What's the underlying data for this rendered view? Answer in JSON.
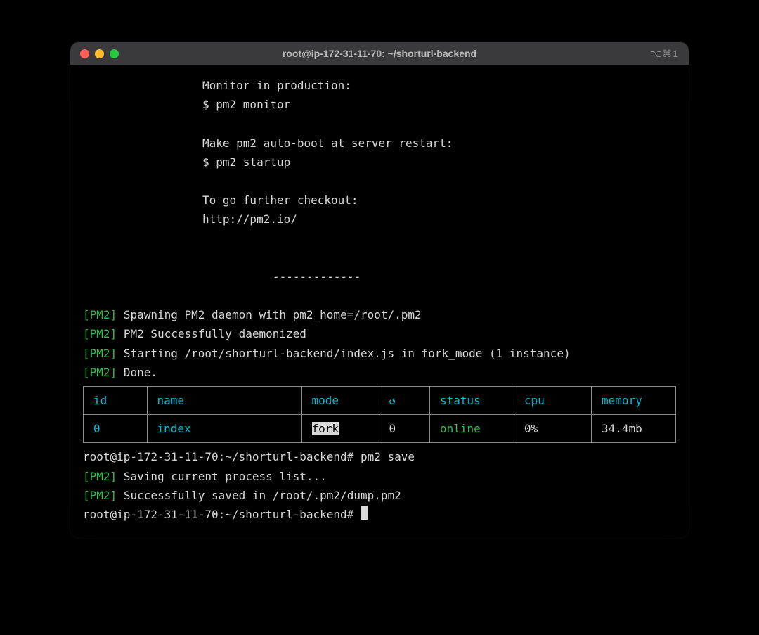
{
  "window": {
    "title": "root@ip-172-31-11-70: ~/shorturl-backend",
    "right_badge": "⌥⌘1"
  },
  "intro": {
    "monitor_label": "Monitor in production:",
    "monitor_cmd": "$ pm2 monitor",
    "autoboot_label": "Make pm2 auto-boot at server restart:",
    "autoboot_cmd": "$ pm2 startup",
    "further_label": "To go further checkout:",
    "further_url": "http://pm2.io/",
    "divider": "-------------"
  },
  "log": {
    "tag": "[PM2]",
    "l1": "Spawning PM2 daemon with pm2_home=/root/.pm2",
    "l2": "PM2 Successfully daemonized",
    "l3": "Starting /root/shorturl-backend/index.js in fork_mode (1 instance)",
    "l4": "Done."
  },
  "table": {
    "headers": {
      "id": "id",
      "name": "name",
      "mode": "mode",
      "restart": "↺",
      "status": "status",
      "cpu": "cpu",
      "memory": "memory"
    },
    "row": {
      "id": "0",
      "name": "index",
      "mode": "fork",
      "restart": "0",
      "status": "online",
      "cpu": "0%",
      "memory": "34.4mb"
    }
  },
  "post": {
    "prompt1": "root@ip-172-31-11-70:~/shorturl-backend# ",
    "cmd1": "pm2 save",
    "save1": "Saving current process list...",
    "save2": "Successfully saved in /root/.pm2/dump.pm2",
    "prompt2": "root@ip-172-31-11-70:~/shorturl-backend# "
  }
}
